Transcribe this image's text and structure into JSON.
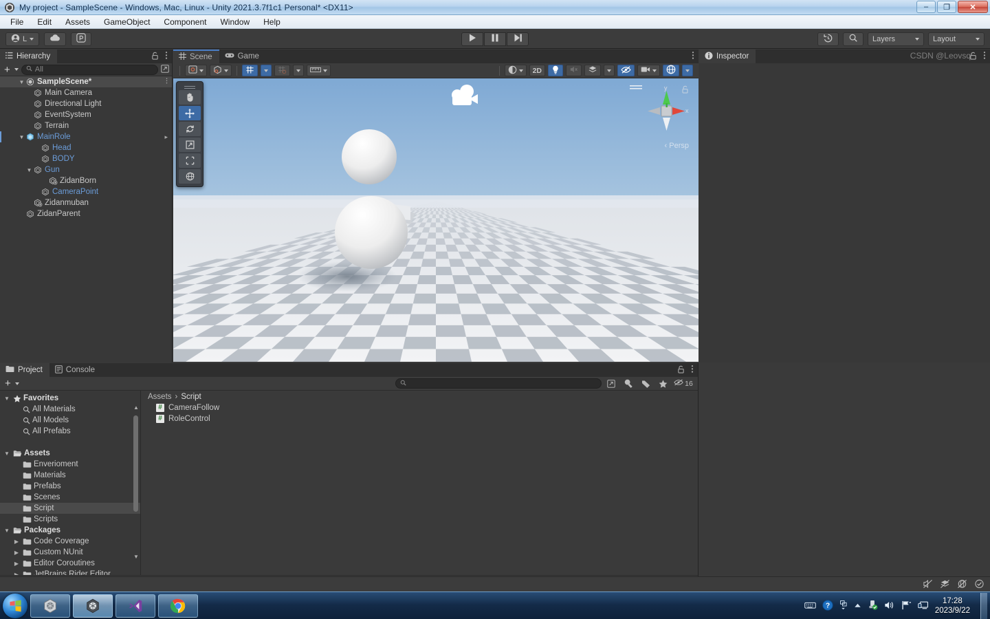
{
  "window": {
    "title": "My project - SampleScene - Windows, Mac, Linux - Unity 2021.3.7f1c1 Personal* <DX11>",
    "minimize_label": "–",
    "restore_label": "❐",
    "close_label": "✕"
  },
  "menubar": {
    "items": [
      "File",
      "Edit",
      "Assets",
      "GameObject",
      "Component",
      "Window",
      "Help"
    ]
  },
  "toolbar": {
    "account_label": "L",
    "cloud_icon": "cloud-icon",
    "services_icon": "unity-services-icon",
    "play_icon": "play-icon",
    "pause_icon": "pause-icon",
    "step_icon": "step-icon",
    "undo_history_icon": "undo-history-icon",
    "search_icon": "search-icon",
    "layers_label": "Layers",
    "layout_label": "Layout"
  },
  "hierarchy": {
    "tab_label": "Hierarchy",
    "lock_icon": "lock-icon",
    "menu_icon": "kebab-menu-icon",
    "add_label": "+",
    "search_placeholder": "All",
    "scene_name": "SampleScene*",
    "items": [
      {
        "label": "Main Camera",
        "indent": 2,
        "twisty": "",
        "icon": "gameobject-icon",
        "blue": false,
        "selected": false
      },
      {
        "label": "Directional Light",
        "indent": 2,
        "twisty": "",
        "icon": "gameobject-icon",
        "blue": false,
        "selected": false
      },
      {
        "label": "EventSystem",
        "indent": 2,
        "twisty": "",
        "icon": "gameobject-icon",
        "blue": false,
        "selected": false
      },
      {
        "label": "Terrain",
        "indent": 2,
        "twisty": "",
        "icon": "gameobject-icon",
        "blue": false,
        "selected": false
      },
      {
        "label": "MainRole",
        "indent": 1,
        "twisty": "▼",
        "icon": "prefab-icon",
        "blue": true,
        "selected": false
      },
      {
        "label": "Head",
        "indent": 3,
        "twisty": "",
        "icon": "gameobject-icon",
        "blue": true,
        "selected": false
      },
      {
        "label": "BODY",
        "indent": 3,
        "twisty": "",
        "icon": "gameobject-icon",
        "blue": true,
        "selected": false
      },
      {
        "label": "Gun",
        "indent": 2,
        "twisty": "▼",
        "icon": "gameobject-icon",
        "blue": true,
        "selected": false
      },
      {
        "label": "ZidanBorn",
        "indent": 4,
        "twisty": "",
        "icon": "gameobject-plus-icon",
        "blue": false,
        "selected": false
      },
      {
        "label": "CameraPoint",
        "indent": 3,
        "twisty": "",
        "icon": "gameobject-icon",
        "blue": true,
        "selected": false
      },
      {
        "label": "Zidanmuban",
        "indent": 2,
        "twisty": "",
        "icon": "gameobject-plus-icon",
        "blue": false,
        "selected": false
      },
      {
        "label": "ZidanParent",
        "indent": 1,
        "twisty": "",
        "icon": "gameobject-icon",
        "blue": false,
        "selected": false
      }
    ]
  },
  "scene": {
    "tabs": [
      {
        "label": "Scene",
        "icon": "grid-icon",
        "active": true
      },
      {
        "label": "Game",
        "icon": "gamepad-icon",
        "active": false
      }
    ],
    "menu_icon": "kebab-menu-icon",
    "tools": [
      {
        "name": "hand-tool",
        "selected": false
      },
      {
        "name": "move-tool",
        "selected": true
      },
      {
        "name": "rotate-tool",
        "selected": false
      },
      {
        "name": "scale-tool",
        "selected": false
      },
      {
        "name": "rect-tool",
        "selected": false
      },
      {
        "name": "transform-tool",
        "selected": false
      }
    ],
    "toolbar_left": [
      {
        "name": "pivot-mode-dropdown",
        "icon": "pivot-center-icon",
        "on": false
      },
      {
        "name": "handle-space-dropdown",
        "icon": "global-local-icon",
        "on": false
      },
      {
        "name": "grid-snapping-toggle",
        "icon": "grid-snap-icon",
        "on": true
      },
      {
        "name": "vertex-snapping-dropdown",
        "icon": "magnet-icon",
        "on": false,
        "dim": true
      },
      {
        "name": "grid-size-dropdown",
        "icon": "ruler-icon",
        "on": false
      }
    ],
    "toolbar_right": [
      {
        "name": "draw-mode-dropdown",
        "icon": "shaded-sphere-icon",
        "on": false,
        "text": ""
      },
      {
        "name": "2d-toggle",
        "icon": "",
        "on": false,
        "text": "2D"
      },
      {
        "name": "scene-lighting-toggle",
        "icon": "lightbulb-icon",
        "on": true,
        "text": ""
      },
      {
        "name": "scene-audio-toggle",
        "icon": "audio-mute-icon",
        "on": false,
        "text": ""
      },
      {
        "name": "effects-dropdown",
        "icon": "effects-icon",
        "on": false,
        "text": ""
      },
      {
        "name": "scene-visibility-toggle",
        "icon": "eye-off-icon",
        "on": true,
        "text": ""
      },
      {
        "name": "camera-settings-dropdown",
        "icon": "camera-icon",
        "on": false,
        "text": ""
      },
      {
        "name": "gizmos-dropdown",
        "icon": "gizmos-icon",
        "on": true,
        "text": ""
      }
    ],
    "gizmo": {
      "perspective_label": "Persp",
      "axis_x": "x",
      "axis_y": "y",
      "lock_icon": "lock-open-icon"
    }
  },
  "inspector": {
    "tab_label": "Inspector",
    "info_icon": "info-icon",
    "lock_icon": "lock-icon",
    "menu_icon": "kebab-menu-icon"
  },
  "project": {
    "tabs": [
      {
        "label": "Project",
        "icon": "folder-icon",
        "active": true
      },
      {
        "label": "Console",
        "icon": "console-icon",
        "active": false
      }
    ],
    "lock_icon": "lock-icon",
    "menu_icon": "kebab-menu-icon",
    "add_label": "+",
    "search_placeholder": "",
    "search_value": "",
    "filter_icons": [
      {
        "name": "save-search-icon",
        "label": ""
      },
      {
        "name": "search-by-type-icon",
        "label": ""
      },
      {
        "name": "search-by-label-icon",
        "label": ""
      },
      {
        "name": "favorites-star-icon",
        "label": ""
      },
      {
        "name": "hidden-packages-icon",
        "label": "16"
      }
    ],
    "tree": [
      {
        "label": "Favorites",
        "indent": 0,
        "twisty": "▼",
        "icon": "star-icon",
        "bold": true,
        "selected": false
      },
      {
        "label": "All Materials",
        "indent": 1,
        "twisty": "",
        "icon": "search-icon",
        "bold": false,
        "selected": false
      },
      {
        "label": "All Models",
        "indent": 1,
        "twisty": "",
        "icon": "search-icon",
        "bold": false,
        "selected": false
      },
      {
        "label": "All Prefabs",
        "indent": 1,
        "twisty": "",
        "icon": "search-icon",
        "bold": false,
        "selected": false
      },
      {
        "label": "",
        "indent": 0,
        "twisty": "",
        "icon": "",
        "bold": false,
        "selected": false
      },
      {
        "label": "Assets",
        "indent": 0,
        "twisty": "▼",
        "icon": "folder-open-icon",
        "bold": true,
        "selected": false
      },
      {
        "label": "Enverioment",
        "indent": 1,
        "twisty": "",
        "icon": "folder-icon",
        "bold": false,
        "selected": false
      },
      {
        "label": "Materials",
        "indent": 1,
        "twisty": "",
        "icon": "folder-icon",
        "bold": false,
        "selected": false
      },
      {
        "label": "Prefabs",
        "indent": 1,
        "twisty": "",
        "icon": "folder-icon",
        "bold": false,
        "selected": false
      },
      {
        "label": "Scenes",
        "indent": 1,
        "twisty": "",
        "icon": "folder-icon",
        "bold": false,
        "selected": false
      },
      {
        "label": "Script",
        "indent": 1,
        "twisty": "",
        "icon": "folder-icon",
        "bold": false,
        "selected": true
      },
      {
        "label": "Scripts",
        "indent": 1,
        "twisty": "",
        "icon": "folder-icon",
        "bold": false,
        "selected": false
      },
      {
        "label": "Packages",
        "indent": 0,
        "twisty": "▼",
        "icon": "folder-open-icon",
        "bold": true,
        "selected": false
      },
      {
        "label": "Code Coverage",
        "indent": 1,
        "twisty": "▶",
        "icon": "folder-icon",
        "bold": false,
        "selected": false
      },
      {
        "label": "Custom NUnit",
        "indent": 1,
        "twisty": "▶",
        "icon": "folder-icon",
        "bold": false,
        "selected": false
      },
      {
        "label": "Editor Coroutines",
        "indent": 1,
        "twisty": "▶",
        "icon": "folder-icon",
        "bold": false,
        "selected": false
      },
      {
        "label": "JetBrains Rider Editor",
        "indent": 1,
        "twisty": "▶",
        "icon": "folder-icon",
        "bold": false,
        "selected": false
      }
    ],
    "breadcrumb": {
      "root": "Assets",
      "separator": "›",
      "current": "Script"
    },
    "assets": [
      {
        "label": "CameraFollow",
        "icon": "csharp-script-icon"
      },
      {
        "label": "RoleControl",
        "icon": "csharp-script-icon"
      }
    ]
  },
  "statusbar": {
    "icons": [
      {
        "name": "mute-audio-icon"
      },
      {
        "name": "layers-off-icon"
      },
      {
        "name": "gizmos-off-icon"
      },
      {
        "name": "check-circle-icon"
      }
    ]
  },
  "taskbar": {
    "start_icon": "windows-start-icon",
    "apps": [
      {
        "name": "taskbar-unity-hub",
        "icon": "unity-icon",
        "active": false
      },
      {
        "name": "taskbar-unity-editor",
        "icon": "unity-icon",
        "active": true
      },
      {
        "name": "taskbar-visual-studio",
        "icon": "visual-studio-icon",
        "active": false
      },
      {
        "name": "taskbar-chrome",
        "icon": "chrome-icon",
        "active": false
      }
    ],
    "tray": [
      {
        "name": "keyboard-layout-icon"
      },
      {
        "name": "help-icon"
      },
      {
        "name": "show-hidden-icons-icon"
      },
      {
        "name": "usb-safely-remove-icon"
      },
      {
        "name": "volume-icon"
      },
      {
        "name": "network-icon"
      },
      {
        "name": "display-icon"
      }
    ],
    "clock_time": "17:28",
    "clock_date": "2023/9/22"
  },
  "watermark": "CSDN @Leovsq"
}
